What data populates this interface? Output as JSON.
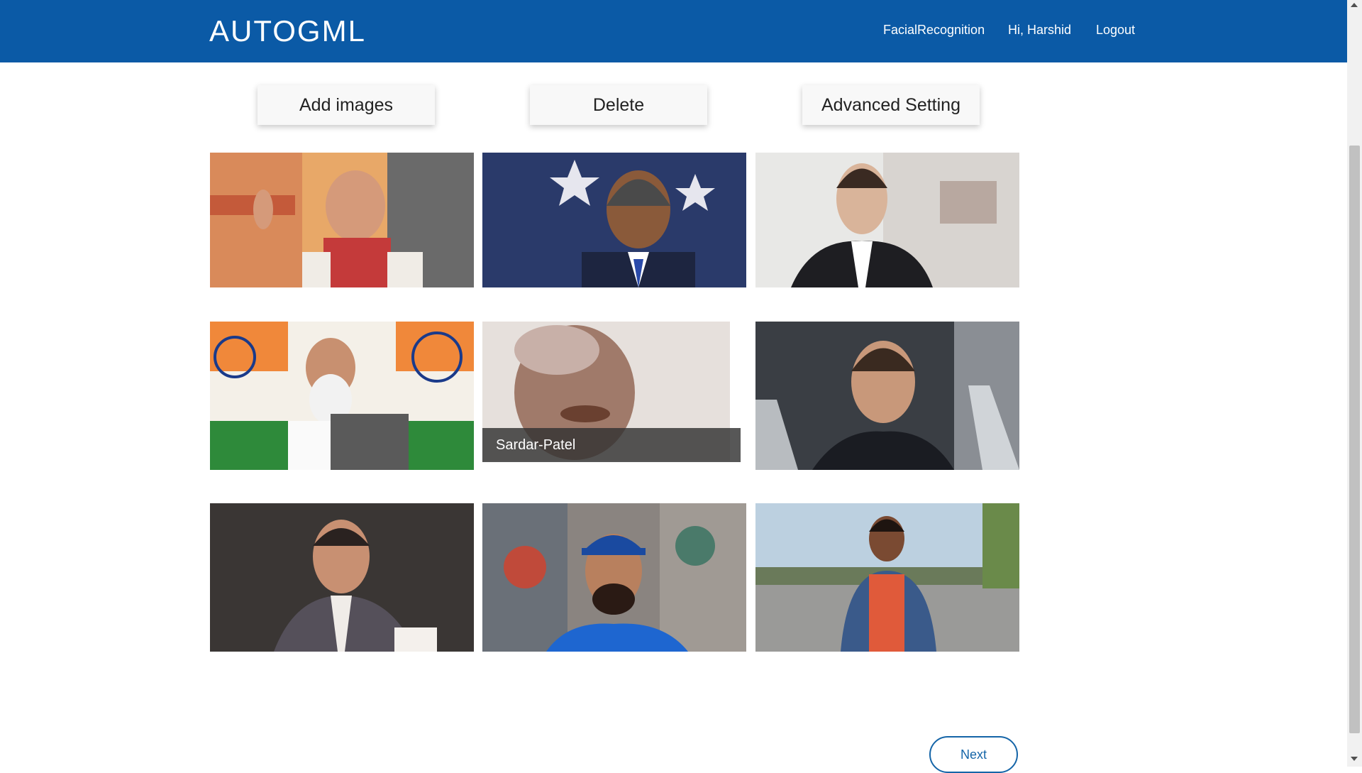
{
  "navbar": {
    "brand": "AUTOGML",
    "links": [
      "FacialRecognition",
      "Hi, Harshid",
      "Logout"
    ],
    "background": "#0b5aa6"
  },
  "actions": {
    "add_label": "Add images",
    "delete_label": "Delete",
    "advanced_label": "Advanced Setting"
  },
  "gallery": {
    "hover_caption": "Sardar-Patel"
  },
  "pagination": {
    "next_label": "Next"
  },
  "colors": {
    "accent": "#1565a8"
  }
}
